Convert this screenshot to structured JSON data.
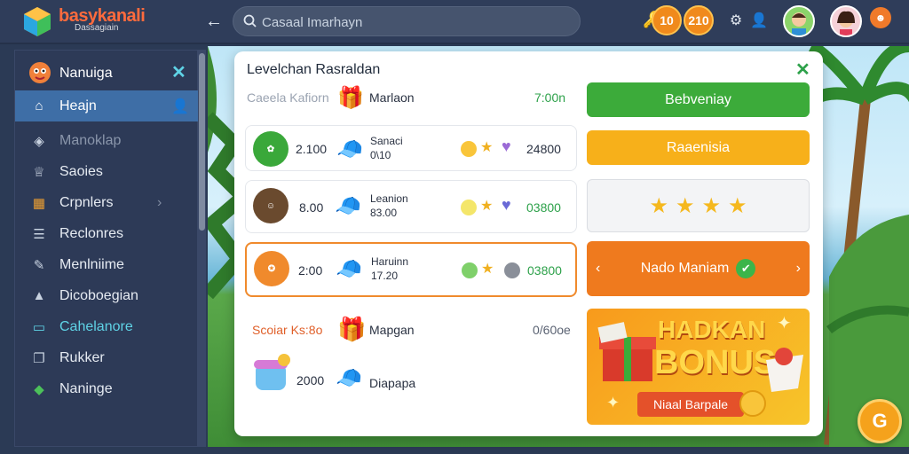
{
  "app": {
    "brand": "basykanali",
    "brand_sub": "Dassagiain"
  },
  "search": {
    "placeholder": "Casaal Imarhayn"
  },
  "topbar": {
    "coin1": "10",
    "coin2": "210"
  },
  "sidebar": {
    "header": "Nanuiga",
    "items": [
      {
        "label": "Heajn",
        "icon": "home-icon"
      },
      {
        "label": "Manoklap",
        "icon": "diamond-icon"
      },
      {
        "label": "Saoies",
        "icon": "trophy-icon"
      },
      {
        "label": "Crpnlers",
        "icon": "calendar-icon"
      },
      {
        "label": "Reclonres",
        "icon": "list-icon"
      },
      {
        "label": "Menlniime",
        "icon": "edit-icon"
      },
      {
        "label": "Dicoboegian",
        "icon": "bag-icon"
      },
      {
        "label": "Cahelanore",
        "icon": "card-icon"
      },
      {
        "label": "Rukker",
        "icon": "copy-icon"
      },
      {
        "label": "Naninge",
        "icon": "tag-icon"
      }
    ]
  },
  "panel": {
    "title": "Levelchan Rasraldan",
    "header_row": {
      "label": "Caeela Kafiorn",
      "name": "Marlaon",
      "value": "7:00n"
    },
    "rows": [
      {
        "badge": "",
        "score": "2.100",
        "name": "Sanaci",
        "sub": "0\\10",
        "points": "24800",
        "accent": "#e45"
      },
      {
        "badge": "",
        "score": "8.00",
        "name": "Leanion",
        "sub": "83.00",
        "points": "03800",
        "accent": "#2a9"
      },
      {
        "badge": "",
        "score": "2:00",
        "name": "Haruinn",
        "sub": "17.20",
        "points": "03800",
        "accent": "#2a9"
      }
    ],
    "footer": {
      "label": "Scoiar Ks:8o",
      "name1": "Mapgan",
      "value1": "0/60oe",
      "score2": "2000",
      "name2": "Diapapa"
    },
    "buttons": {
      "b1": "Bebveniay",
      "b2": "Raaenisia",
      "b4": "Nado Maniam"
    },
    "bonus": {
      "title1": "HADKAN",
      "title2": "BONUS",
      "cta": "Niaal Barpale"
    }
  },
  "fab": "G"
}
